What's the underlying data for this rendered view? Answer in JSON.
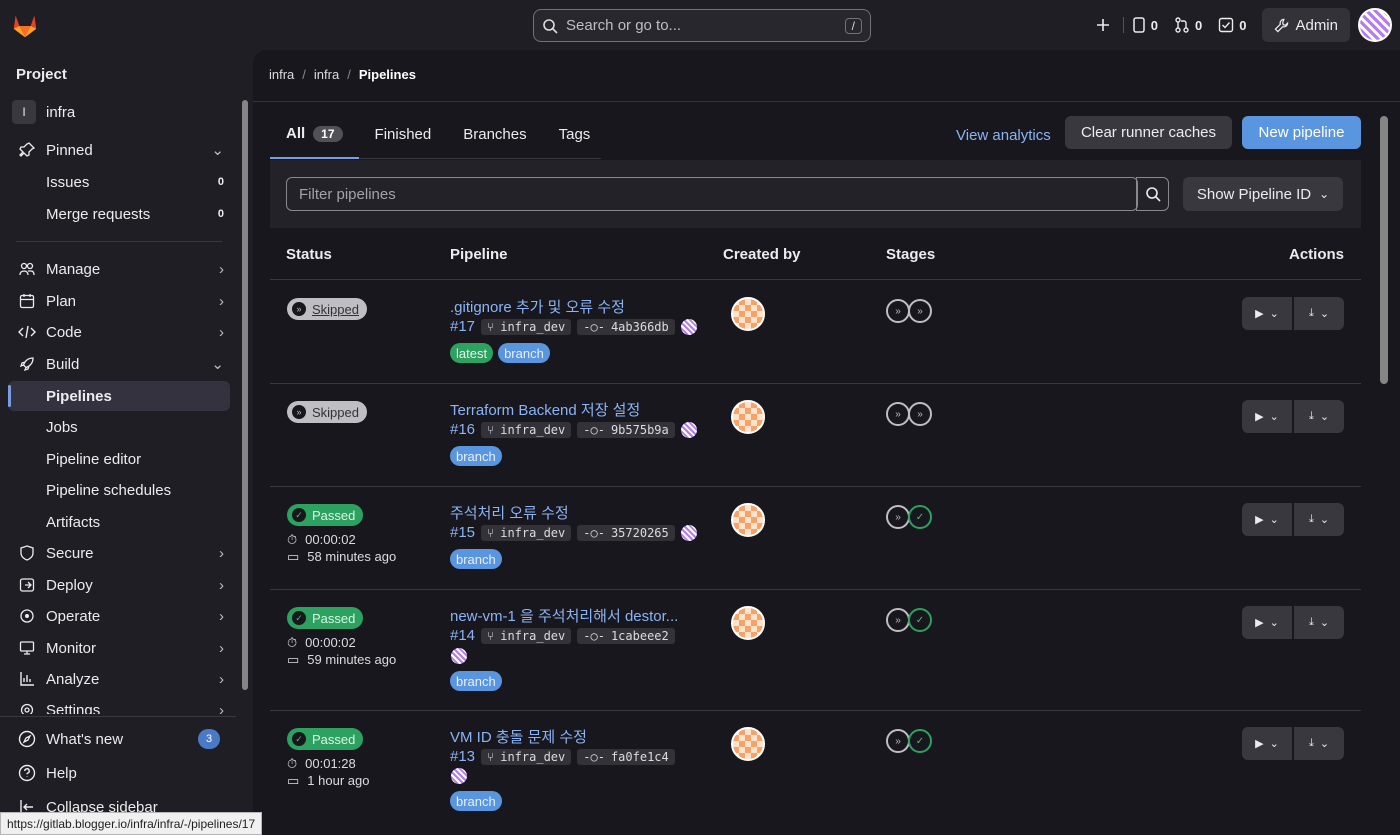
{
  "topbar": {
    "search_placeholder": "Search or go to...",
    "search_shortcut": "/",
    "issues_count": "0",
    "mr_count": "0",
    "todo_count": "0",
    "admin_label": "Admin"
  },
  "sidebar": {
    "heading": "Project",
    "project_initial": "I",
    "project_name": "infra",
    "pinned": "Pinned",
    "pinned_items": [
      {
        "label": "Issues",
        "count": "0"
      },
      {
        "label": "Merge requests",
        "count": "0"
      }
    ],
    "sections": [
      {
        "label": "Manage",
        "icon": "users-icon"
      },
      {
        "label": "Plan",
        "icon": "calendar-icon"
      },
      {
        "label": "Code",
        "icon": "code-icon"
      },
      {
        "label": "Build",
        "icon": "rocket-icon"
      }
    ],
    "build_items": [
      "Pipelines",
      "Jobs",
      "Pipeline editor",
      "Pipeline schedules",
      "Artifacts"
    ],
    "more_sections": [
      {
        "label": "Secure",
        "icon": "shield-icon"
      },
      {
        "label": "Deploy",
        "icon": "deploy-icon"
      },
      {
        "label": "Operate",
        "icon": "operate-icon"
      },
      {
        "label": "Monitor",
        "icon": "monitor-icon"
      },
      {
        "label": "Analyze",
        "icon": "chart-icon"
      },
      {
        "label": "Settings",
        "icon": "settings-icon"
      }
    ],
    "whats_new": "What's new",
    "whats_new_count": "3",
    "help": "Help",
    "collapse": "Collapse sidebar"
  },
  "status_url": "https://gitlab.blogger.io/infra/infra/-/pipelines/17",
  "breadcrumb": [
    "infra",
    "infra",
    "Pipelines"
  ],
  "tabs": [
    {
      "label": "All",
      "count": "17"
    },
    {
      "label": "Finished"
    },
    {
      "label": "Branches"
    },
    {
      "label": "Tags"
    }
  ],
  "toolbar": {
    "analytics": "View analytics",
    "clear_caches": "Clear runner caches",
    "new_pipeline": "New pipeline"
  },
  "filter": {
    "placeholder": "Filter pipelines",
    "show_id": "Show Pipeline ID"
  },
  "columns": [
    "Status",
    "Pipeline",
    "Created by",
    "Stages",
    "Actions"
  ],
  "pipelines": [
    {
      "status": "Skipped",
      "title": ".gitignore 추가 및 오류 수정",
      "id": "#17",
      "branch": "infra_dev",
      "sha": "4ab366db",
      "tags": [
        "latest",
        "branch"
      ]
    },
    {
      "status": "Skipped",
      "title": "Terraform Backend 저장 설정",
      "id": "#16",
      "branch": "infra_dev",
      "sha": "9b575b9a",
      "tags": [
        "branch"
      ]
    },
    {
      "status": "Passed",
      "duration": "00:00:02",
      "finished": "58 minutes ago",
      "title": "주석처리 오류 수정",
      "id": "#15",
      "branch": "infra_dev",
      "sha": "35720265",
      "tags": [
        "branch"
      ]
    },
    {
      "status": "Passed",
      "duration": "00:00:02",
      "finished": "59 minutes ago",
      "title": "new-vm-1 을 주석처리해서 destor...",
      "id": "#14",
      "branch": "infra_dev",
      "sha": "1cabeee2",
      "tags": [
        "branch"
      ]
    },
    {
      "status": "Passed",
      "duration": "00:01:28",
      "finished": "1 hour ago",
      "title": "VM ID 충돌 문제 수정",
      "id": "#13",
      "branch": "infra_dev",
      "sha": "fa0fe1c4",
      "tags": [
        "branch"
      ]
    }
  ]
}
